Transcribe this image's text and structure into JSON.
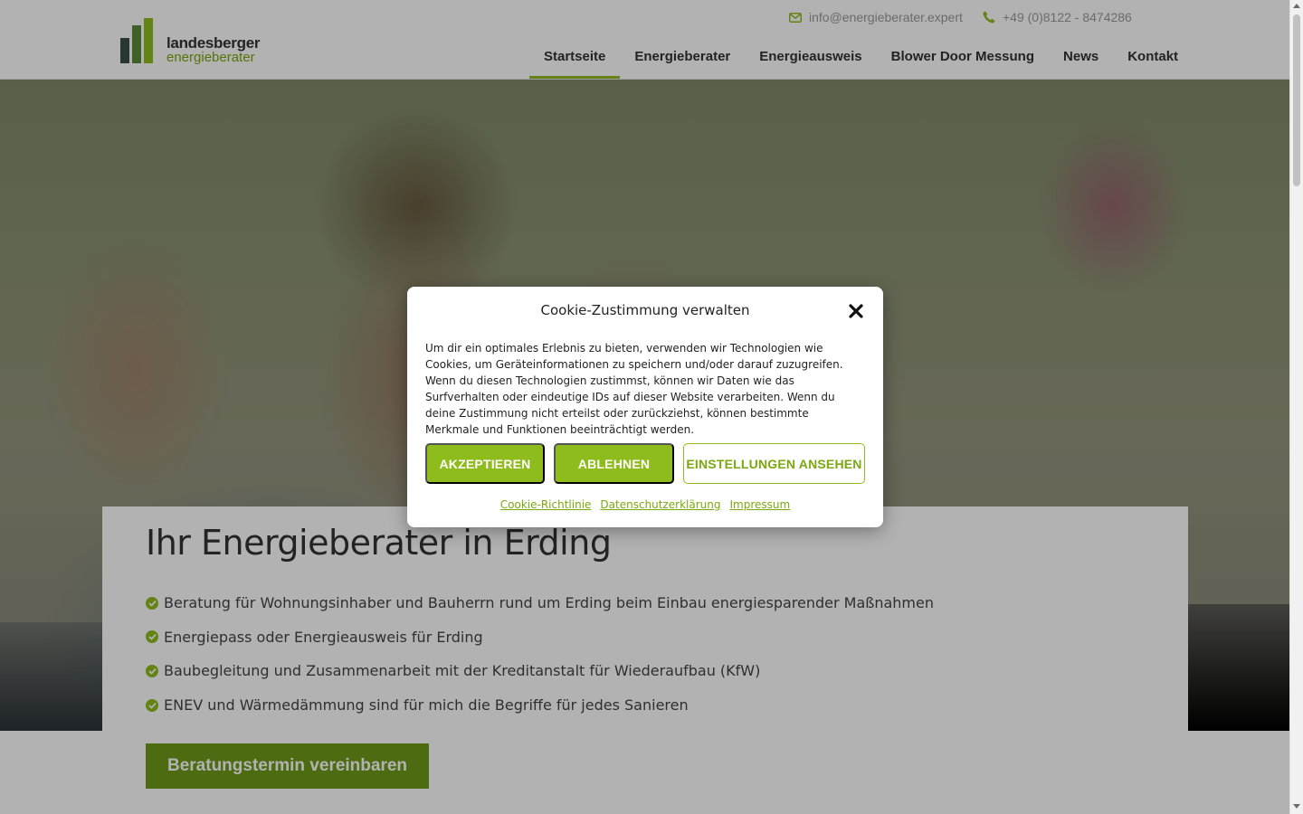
{
  "header": {
    "logo": {
      "line1": "landesberger",
      "line2": "energieberater"
    },
    "email": "info@energieberater.expert",
    "phone": "+49 (0)8122 - 8474286",
    "nav": [
      {
        "label": "Startseite",
        "active": true
      },
      {
        "label": "Energieberater"
      },
      {
        "label": "Energieausweis"
      },
      {
        "label": "Blower Door Messung"
      },
      {
        "label": "News"
      },
      {
        "label": "Kontakt"
      }
    ]
  },
  "hero": {
    "image": "family-with-pinwheel-photo"
  },
  "main": {
    "title": "Ihr Energieberater in Erding",
    "features": [
      "Beratung für Wohnungsinhaber und Bauherrn rund um Erding beim Einbau energiesparender Maßnahmen",
      "Energiepass oder Energieausweis für Erding",
      "Baubegleitung und Zusammenarbeit mit der Kreditanstalt für Wiederaufbau (KfW)",
      "ENEV und Wärmedämmung sind für mich die Begriffe für jedes Sanieren"
    ],
    "cta_label": "Beratungstermin vereinbaren"
  },
  "cookie": {
    "title": "Cookie-Zustimmung verwalten",
    "text": "Um dir ein optimales Erlebnis zu bieten, verwenden wir Technologien wie Cookies, um Geräteinformationen zu speichern und/oder darauf zuzugreifen. Wenn du diesen Technologien zustimmst, können wir Daten wie das Surfverhalten oder eindeutige IDs auf dieser Website verarbeiten. Wenn du deine Zustimmung nicht erteilst oder zurückziehst, können bestimmte Merkmale und Funktionen beeinträchtigt werden.",
    "accept_label": "AKZEPTIEREN",
    "deny_label": "ABLEHNEN",
    "settings_label": "EINSTELLUNGEN ANSEHEN",
    "links": [
      "Cookie-Richtlinie",
      "Datenschutzerklärung",
      "Impressum"
    ]
  },
  "colors": {
    "accent": "#8fbc1d",
    "cta": "#6f9a19",
    "text": "#333333"
  }
}
